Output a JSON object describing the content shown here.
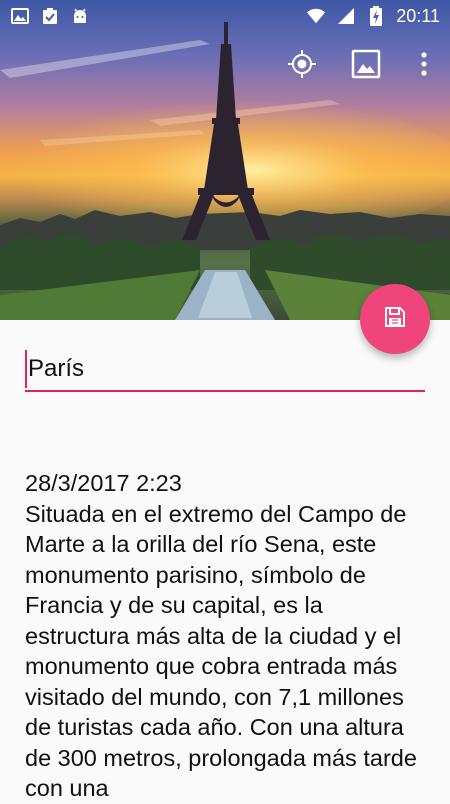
{
  "status_bar": {
    "time": "20:11",
    "left_icons": [
      "image-icon",
      "clipboard-check-icon",
      "android-icon"
    ],
    "right_icons": [
      "wifi-icon",
      "signal-icon",
      "battery-charging-icon"
    ]
  },
  "toolbar": {
    "actions": [
      "location-target-icon",
      "image-icon",
      "more-vert-icon"
    ]
  },
  "fab": {
    "icon": "save-icon",
    "color": "#f0457c"
  },
  "title_input": {
    "value": "París"
  },
  "note": {
    "date": "28/3/2017  2:23",
    "text": "Situada en el extremo del Campo de Marte a la orilla del río Sena, este monumento parisino, símbolo de Francia y de su capital, es la estructura más alta de la ciudad y el monumento que cobra entrada más visitado del mundo, con 7,1 millones de turistas cada año. Con una altura de 300 metros, prolongada más tarde con una"
  },
  "colors": {
    "accent": "#e91e63",
    "fab": "#f0457c"
  }
}
